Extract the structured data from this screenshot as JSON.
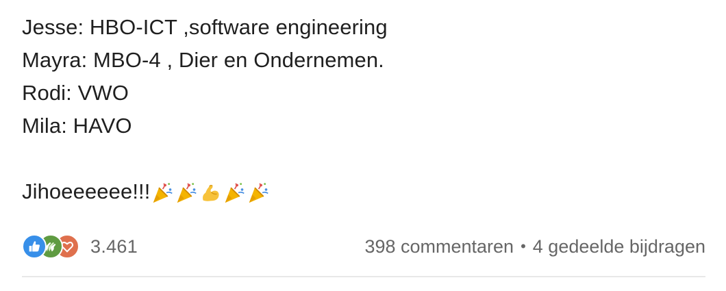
{
  "post": {
    "lines": [
      "Jesse: HBO-ICT ,software engineering",
      "Mayra: MBO-4 , Dier en Ondernemen.",
      "Rodi: VWO",
      "Mila: HAVO"
    ],
    "closing_text": "Jihoeeeeee!!!",
    "closing_emojis": [
      "party-popper-icon",
      "party-popper-icon",
      "flexed-biceps-icon",
      "party-popper-icon",
      "party-popper-icon"
    ]
  },
  "social": {
    "reaction_types": [
      "like-icon",
      "celebrate-icon",
      "love-icon"
    ],
    "reaction_count": "3.461",
    "comments": "398 commentaren",
    "separator": "•",
    "reposts": "4 gedeelde bijdragen"
  },
  "colors": {
    "like": "#378fe9",
    "celebrate": "#5f9b41",
    "love": "#df704d",
    "text": "#1f1f1f",
    "muted": "#666666"
  }
}
